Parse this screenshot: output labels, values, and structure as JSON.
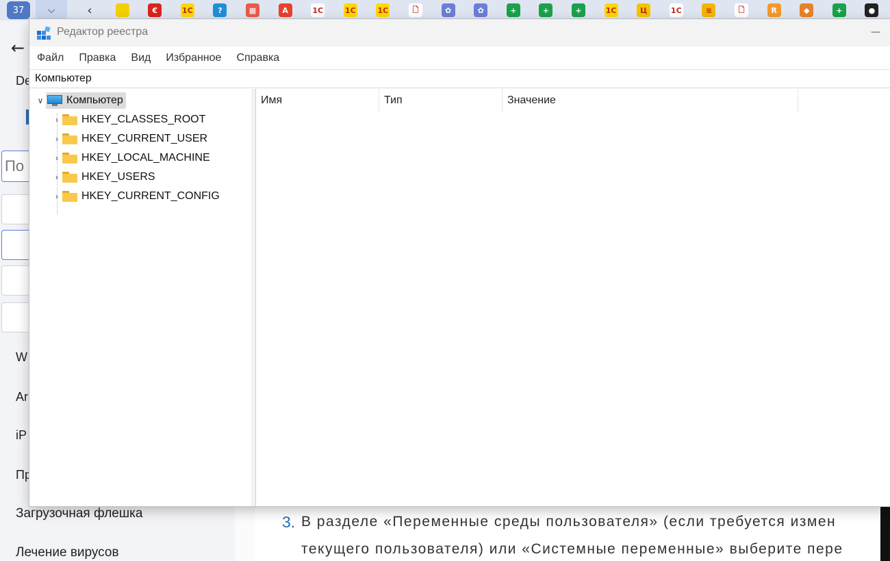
{
  "taskbar": {
    "counter": "37",
    "tabs": [
      {
        "icon": "back-arrow-icon"
      },
      {
        "icon": "yellow-app-icon",
        "color": "#f5d000",
        "text": ""
      },
      {
        "icon": "red-spiral-icon",
        "color": "#d9251d",
        "text": "€"
      },
      {
        "icon": "1c-app-icon",
        "color": "#ffd800",
        "text": "1С"
      },
      {
        "icon": "question-app-icon",
        "color": "#1e90d6",
        "text": "?"
      },
      {
        "icon": "red-grid-icon",
        "color": "#e95b4a",
        "text": "▦"
      },
      {
        "icon": "adobe-icon",
        "color": "#e8412c",
        "text": "A"
      },
      {
        "icon": "1c-red-icon",
        "color": "#ffffff",
        "text": "1С"
      },
      {
        "icon": "1c-app-icon",
        "color": "#ffd800",
        "text": "1С"
      },
      {
        "icon": "1c-app-icon",
        "color": "#ffd800",
        "text": "1С"
      },
      {
        "icon": "document-icon",
        "color": "#ffffff",
        "text": "🗋"
      },
      {
        "icon": "pattern-icon",
        "color": "#6b7fd6",
        "text": "✿"
      },
      {
        "icon": "pattern-icon",
        "color": "#6b7fd6",
        "text": "✿"
      },
      {
        "icon": "green-plus-icon",
        "color": "#1aa14b",
        "text": "+"
      },
      {
        "icon": "green-plus-icon",
        "color": "#1aa14b",
        "text": "+"
      },
      {
        "icon": "green-plus-icon",
        "color": "#1aa14b",
        "text": "+"
      },
      {
        "icon": "1c-app-icon",
        "color": "#ffd800",
        "text": "1С"
      },
      {
        "icon": "calendar-app-icon",
        "color": "#f5c400",
        "text": "Ц"
      },
      {
        "icon": "1c-red-icon",
        "color": "#ffffff",
        "text": "1С"
      },
      {
        "icon": "orange-swirl-icon",
        "color": "#f2b600",
        "text": "≋"
      },
      {
        "icon": "document-icon",
        "color": "#ffffff",
        "text": "🗋"
      },
      {
        "icon": "orange-app-icon",
        "color": "#f29a2e",
        "text": "R"
      },
      {
        "icon": "orange-diamond-icon",
        "color": "#e8822a",
        "text": "◆"
      },
      {
        "icon": "green-plus-icon",
        "color": "#1aa14b",
        "text": "+"
      },
      {
        "icon": "github-icon",
        "color": "#222222",
        "text": "●"
      }
    ]
  },
  "background": {
    "sidebar_fragments": [
      "De",
      "По",
      "W",
      "Ar",
      "iP",
      "Пр"
    ],
    "menu_items": [
      "Загрузочная флешка",
      "Лечение вирусов"
    ],
    "step_number": "3.",
    "paragraph_line1": "В разделе «Переменные среды пользователя» (если требуется измен",
    "paragraph_line2": "текущего пользователя) или «Системные переменные» выберите пере"
  },
  "window": {
    "title": "Редактор реестра",
    "menu": [
      "Файл",
      "Правка",
      "Вид",
      "Избранное",
      "Справка"
    ],
    "address": "Компьютер",
    "tree": {
      "root": "Компьютер",
      "hives": [
        "HKEY_CLASSES_ROOT",
        "HKEY_CURRENT_USER",
        "HKEY_LOCAL_MACHINE",
        "HKEY_USERS",
        "HKEY_CURRENT_CONFIG"
      ]
    },
    "columns": [
      "Имя",
      "Тип",
      "Значение"
    ]
  }
}
